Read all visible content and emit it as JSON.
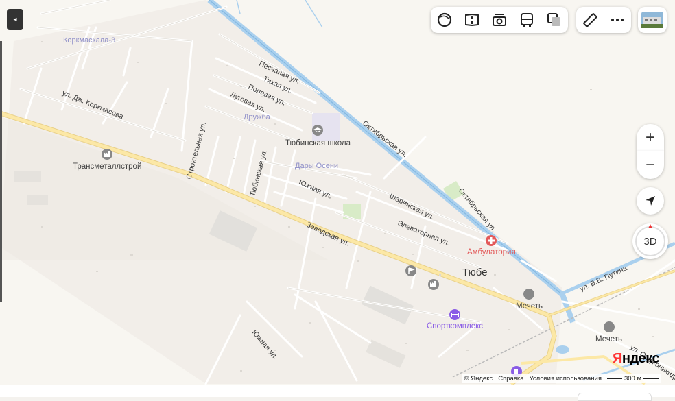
{
  "map": {
    "places": [
      "Коркмаскала-3",
      "Дружба",
      "Дары Осени"
    ],
    "town": "Тюбе",
    "streets": {
      "peschanaya": "Песчаная ул.",
      "tikhaya": "Тихая ул.",
      "polevaya": "Полевая ул.",
      "lugovaya": "Луговая ул.",
      "korkmasova": "ул. Дж. Коркмасова",
      "stroitelnaya": "Строительная ул.",
      "tyubinskaya": "Тюбинская ул.",
      "yuzhnaya1": "Южная ул.",
      "yuzhnaya2": "Южная ул.",
      "oktyabrskaya1": "Октябрьская ул.",
      "oktyabrskaya2": "Октябрьская ул.",
      "sharinskaya": "Шаринская ул.",
      "elevatornaya": "Элеваторная ул.",
      "zavodskaya": "Заводская ул.",
      "putina": "ул. В.В. Путина",
      "ordzhonikidze": "ул. Орджоникидзе"
    },
    "pois": {
      "transmetall": "Трансметаллстрой",
      "school": "Тюбинская школа",
      "ambulatoria": "Амбулатория",
      "mosque1": "Мечеть",
      "mosque2": "Мечеть",
      "sport": "Спорткомплекс"
    }
  },
  "toolbar": {
    "layers_icon": "layers-icon",
    "panorama_icon": "panorama-icon",
    "photo_icon": "camera-icon",
    "transport_icon": "bus-icon",
    "map_type_icon": "map-type-icon",
    "ruler_icon": "ruler-icon",
    "more_icon": "more-icon",
    "thumb_icon": "panorama-thumbnail"
  },
  "controls": {
    "zoom_in": "+",
    "zoom_out": "−",
    "mode_3d": "3D",
    "toggle": "◂"
  },
  "footer": {
    "copyright": "© Яндекс",
    "help": "Справка",
    "terms": "Условия использования",
    "scale": "300 м"
  },
  "logo": {
    "first": "Я",
    "rest": "ндекс"
  },
  "colors": {
    "land": "#f4f2ee",
    "main_road": "#fce8a6",
    "water": "#aad0ee",
    "hospital": "#e35a5a",
    "sport": "#8a5ce6",
    "place_label": "#8e8ec8"
  }
}
